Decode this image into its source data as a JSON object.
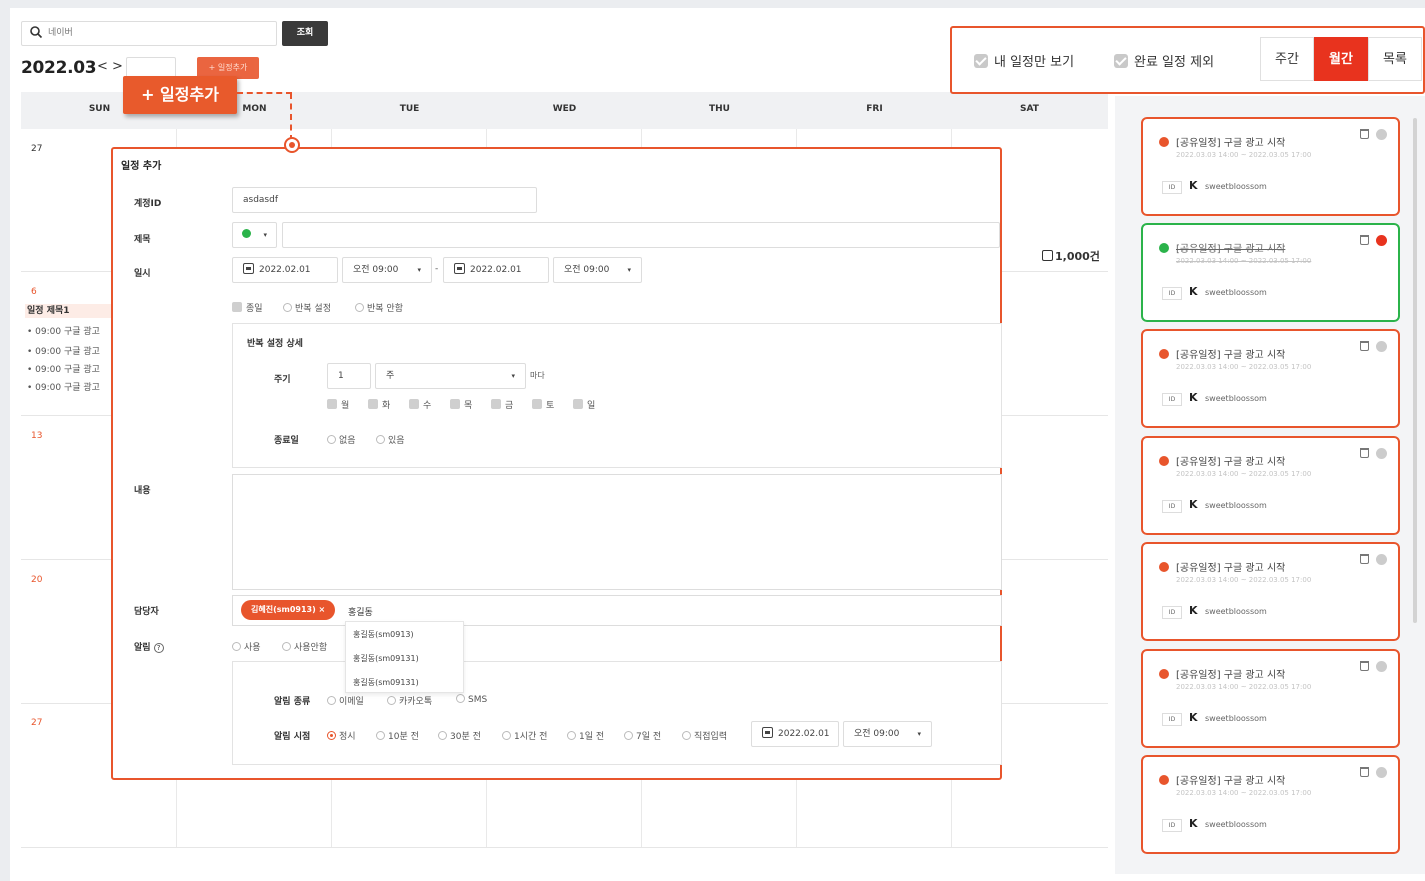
{
  "search": {
    "value": "네이버",
    "button_label": "조회"
  },
  "calendar": {
    "month_title": "2022.03",
    "nav_arrows": "< >",
    "add_button_label": "+ 일정추가",
    "ghost_add_label": "+ 일정추가",
    "weekdays": [
      "SUN",
      "MON",
      "TUE",
      "WED",
      "THU",
      "FRI",
      "SAT"
    ],
    "day_numbers": [
      "27",
      "6",
      "13",
      "20",
      "27"
    ],
    "event_title": "일정 제목1",
    "event_lines": [
      "• 09:00 구글 광고",
      "• 09:00 구글 광고",
      "• 09:00 구글 광고",
      "• 09:00 구글 광고"
    ],
    "count_label": "1,000건"
  },
  "view_options": {
    "my_only_label": "내 일정만 보기",
    "exclude_done_label": "완료 일정 제외",
    "tabs": [
      "주간",
      "월간",
      "목록"
    ],
    "active_tab": "월간"
  },
  "modal": {
    "title": "일정 추가",
    "account_label": "계정ID",
    "account_value": "asdasdf",
    "subject_label": "제목",
    "datetime_label": "일시",
    "start_date": "2022.02.01",
    "start_time": "오전 09:00",
    "end_date": "2022.02.01",
    "end_time": "오전 09:00",
    "range_sep": "-",
    "allday_label": "종일",
    "repeat_on_label": "반복 설정",
    "repeat_off_label": "반복 안함",
    "repeat_detail_title": "반복 설정 상세",
    "cycle_label": "주기",
    "cycle_value": "1",
    "cycle_unit": "주",
    "cycle_suffix": "마다",
    "weekdays": [
      "월",
      "화",
      "수",
      "목",
      "금",
      "토",
      "일"
    ],
    "end_label": "종료일",
    "end_none": "없음",
    "end_some": "있음",
    "content_label": "내용",
    "assignee_label": "담당자",
    "assignee_tag": "김혜진(sm0913) ×",
    "assignee_input": "홍길동",
    "suggestions": [
      "홍길동(sm0913)",
      "홍길동(sm09131)",
      "홍길동(sm09131)"
    ],
    "alarm_label": "알림",
    "alarm_use": "사용",
    "alarm_nouse": "사용안함",
    "alarm_type_label": "알림 종류",
    "alarm_types": [
      "이메일",
      "카카오톡",
      "SMS"
    ],
    "alarm_time_label": "알림 시점",
    "alarm_times": [
      "정시",
      "10분 전",
      "30분 전",
      "1시간 전",
      "1일 전",
      "7일 전",
      "직접입력"
    ],
    "alarm_date": "2022.02.01",
    "alarm_time": "오전 09:00"
  },
  "side_cards": [
    {
      "title": "[공유일정] 구글 광고 시작",
      "date": "2022.03.03 14:00 ~ 2022.03.05 17:00",
      "id_badge": "ID",
      "k_icon": "K",
      "user": "sweetbloossom",
      "done": false
    },
    {
      "title": "[공유일정] 구글 광고 시작",
      "date": "2022.03.03 14:00 ~ 2022.03.05 17:00",
      "id_badge": "ID",
      "k_icon": "K",
      "user": "sweetbloossom",
      "done": true
    },
    {
      "title": "[공유일정] 구글 광고 시작",
      "date": "2022.03.03 14:00 ~ 2022.03.05 17:00",
      "id_badge": "ID",
      "k_icon": "K",
      "user": "sweetbloossom",
      "done": false
    },
    {
      "title": "[공유일정] 구글 광고 시작",
      "date": "2022.03.03 14:00 ~ 2022.03.05 17:00",
      "id_badge": "ID",
      "k_icon": "K",
      "user": "sweetbloossom",
      "done": false
    },
    {
      "title": "[공유일정] 구글 광고 시작",
      "date": "2022.03.03 14:00 ~ 2022.03.05 17:00",
      "id_badge": "ID",
      "k_icon": "K",
      "user": "sweetbloossom",
      "done": false
    },
    {
      "title": "[공유일정] 구글 광고 시작",
      "date": "2022.03.03 14:00 ~ 2022.03.05 17:00",
      "id_badge": "ID",
      "k_icon": "K",
      "user": "sweetbloossom",
      "done": false
    },
    {
      "title": "[공유일정] 구글 광고 시작",
      "date": "2022.03.03 14:00 ~ 2022.03.05 17:00",
      "id_badge": "ID",
      "k_icon": "K",
      "user": "sweetbloossom",
      "done": false
    }
  ],
  "colors": {
    "accent": "#e8552c",
    "active_tab": "#e8331e",
    "done_green": "#2bb34a"
  }
}
